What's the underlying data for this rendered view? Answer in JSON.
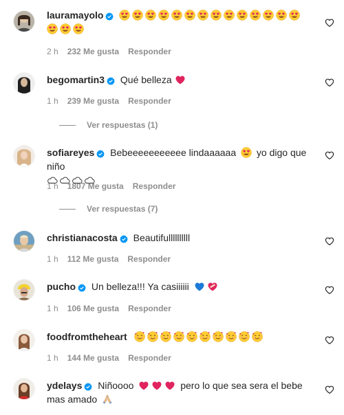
{
  "comments": [
    {
      "username": "lauramayolo",
      "text": "",
      "emoji": "😍😍😍😍😍😍😍😍😍😍😍😍😍😍😍😍😍",
      "time": "2 h",
      "likes": "232 Me gusta",
      "reply": "Responder"
    },
    {
      "username": "begomartin3",
      "text": "Qué belleza",
      "emoji": "❤️",
      "time": "1 h",
      "likes": "239 Me gusta",
      "reply": "Responder",
      "view_replies": "Ver respuestas (1)"
    },
    {
      "username": "sofiareyes",
      "text": "Bebeeeeeeeeeee lindaaaaaa",
      "text2": "yo digo que niño",
      "emoji": "😍",
      "emoji2": "☁️☁️☁️☁️",
      "time": "1 h",
      "likes": "1807 Me gusta",
      "reply": "Responder",
      "view_replies": "Ver respuestas (7)"
    },
    {
      "username": "christianacosta",
      "text": "Beautifullllllllll",
      "time": "1 h",
      "likes": "112 Me gusta",
      "reply": "Responder"
    },
    {
      "username": "pucho",
      "text": "Un belleza!!! Ya casiiiiii",
      "emoji": "💙❤️‍🩹",
      "time": "1 h",
      "likes": "106 Me gusta",
      "reply": "Responder"
    },
    {
      "username": "foodfromtheheart",
      "text": "",
      "emoji": "🥰🥰🥰🥰🥰🥰🥰🥰🥰🥰",
      "time": "1 h",
      "likes": "144 Me gusta",
      "reply": "Responder"
    },
    {
      "username": "ydelays",
      "text": "Niñoooo",
      "emoji": "❤️❤️❤️",
      "text2": "pero lo que sea sera el bebe mas amado",
      "emoji2": "🙏"
    }
  ],
  "colors": {
    "verified": "#0095f6",
    "meta": "#8e8e8e",
    "heart": "#ed4956"
  },
  "icons": {
    "like": "heart-outline-icon",
    "verified": "verified-badge-icon"
  }
}
